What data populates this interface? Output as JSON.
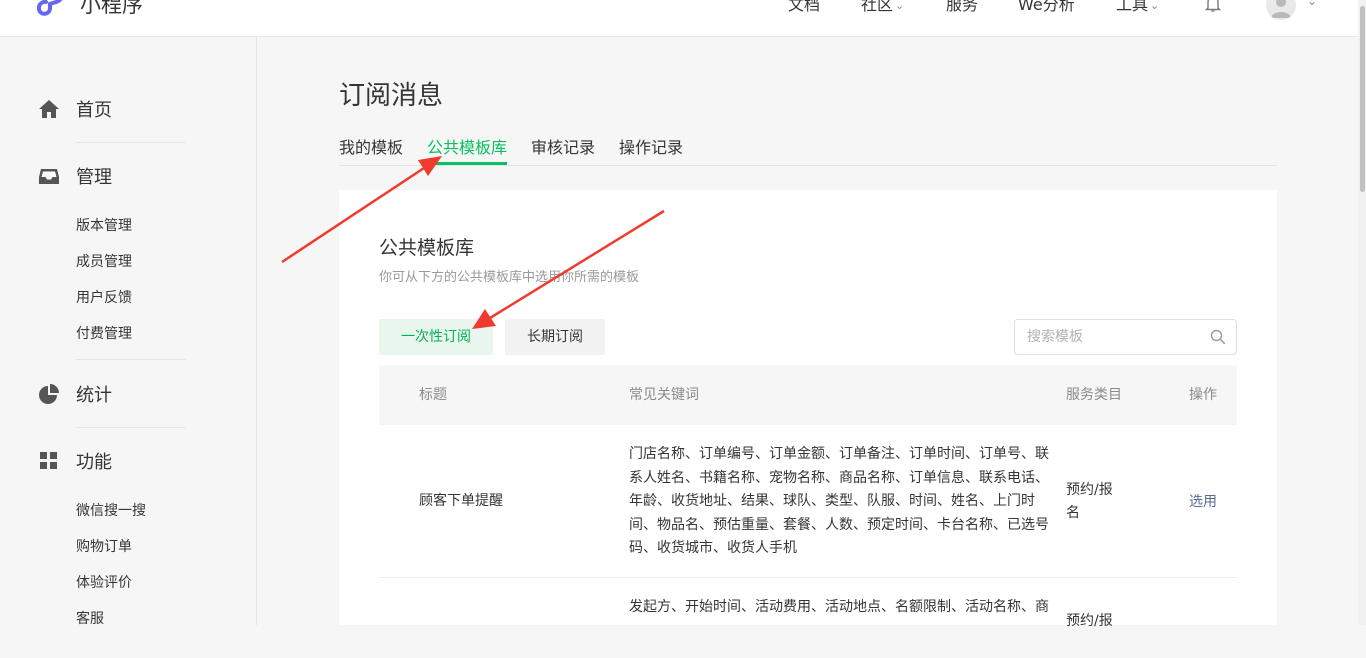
{
  "header": {
    "logo_text": "小程序",
    "nav": [
      "文档",
      "社区",
      "服务",
      "We分析",
      "工具"
    ],
    "icons": [
      "bell-icon",
      "avatar-icon",
      "chevron-down-icon"
    ]
  },
  "sidebar": {
    "home": "首页",
    "manage": "管理",
    "manage_items": [
      "版本管理",
      "成员管理",
      "用户反馈",
      "付费管理"
    ],
    "stats": "统计",
    "features": "功能",
    "feature_items": [
      "微信搜一搜",
      "购物订单",
      "体验评价",
      "客服"
    ]
  },
  "page": {
    "title": "订阅消息",
    "tabs": [
      "我的模板",
      "公共模板库",
      "审核记录",
      "操作记录"
    ],
    "active_tab": "公共模板库"
  },
  "library": {
    "title": "公共模板库",
    "description": "你可从下方的公共模板库中选用你所需的模板",
    "type_buttons": [
      "一次性订阅",
      "长期订阅"
    ],
    "search_placeholder": "搜索模板"
  },
  "table": {
    "columns": [
      "标题",
      "常见关键词",
      "服务类目",
      "操作"
    ],
    "rows": [
      {
        "title": "顾客下单提醒",
        "keywords": "门店名称、订单编号、订单金额、订单备注、订单时间、订单号、联系人姓名、书籍名称、宠物名称、商品名称、订单信息、联系电话、年龄、收货地址、结果、球队、类型、队服、时间、姓名、上门时间、物品名、预估重量、套餐、人数、预定时间、卡台名称、已选号码、收货城市、收货人手机",
        "category": "预约/报名",
        "action": "选用"
      },
      {
        "title": "",
        "keywords": "发起方、开始时间、活动费用、活动地点、名额限制、活动名称、商",
        "category": "预约/报",
        "action": ""
      }
    ]
  },
  "colors": {
    "accent": "#07c160",
    "link": "#576b95",
    "annotation": "#f03a2e"
  }
}
